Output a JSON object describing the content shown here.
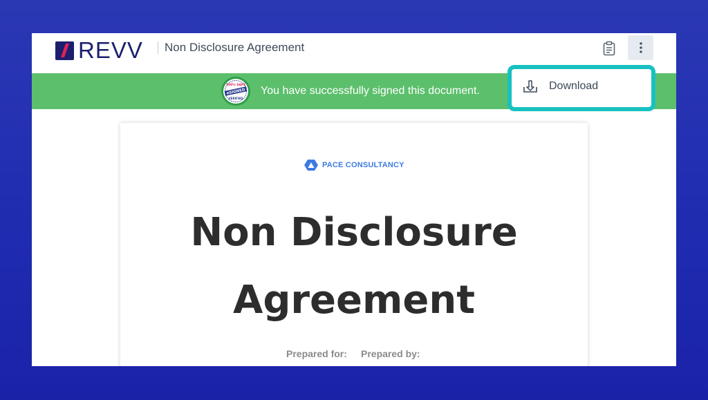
{
  "app": {
    "logo_text": "REVV",
    "doc_title": "Non Disclosure Agreement"
  },
  "header": {
    "clipboard_icon": "clipboard-icon",
    "more_icon": "vertical-dots-icon"
  },
  "banner": {
    "message": "You have successfully signed this document.",
    "seal_text_top": "100% SAFE",
    "seal_text_mid": "eSIGNED",
    "seal_text_bottom": "VERIFIED",
    "color": "#5cbf6c"
  },
  "menu": {
    "items": [
      {
        "label": "Download",
        "icon": "download-icon"
      }
    ],
    "highlight_color": "#18c1c1"
  },
  "document": {
    "company": "PACE CONSULTANCY",
    "title_line1": "Non Disclosure",
    "title_line2": "Agreement",
    "prepared_for": "Prepared for:",
    "prepared_by": "Prepared by:"
  },
  "colors": {
    "brand": "#1b1f6e",
    "accent": "#e0215a",
    "link": "#3d7be0",
    "background": "#2b38b4"
  }
}
